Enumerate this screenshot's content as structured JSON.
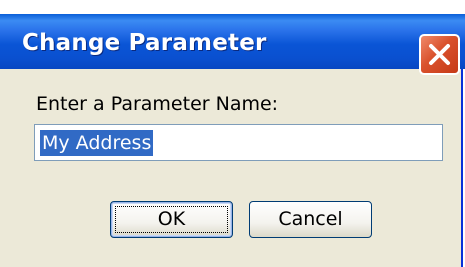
{
  "window": {
    "title": "Change Parameter",
    "close_icon": "close-x-icon"
  },
  "form": {
    "prompt": "Enter a Parameter Name:",
    "parameter_name_value": "My Address"
  },
  "buttons": {
    "ok_label": "OK",
    "cancel_label": "Cancel"
  },
  "colors": {
    "titlebar": "#0a55d6",
    "dialog_background": "#ece9d8",
    "selection": "#316ac5",
    "close_button": "#d9512c"
  }
}
